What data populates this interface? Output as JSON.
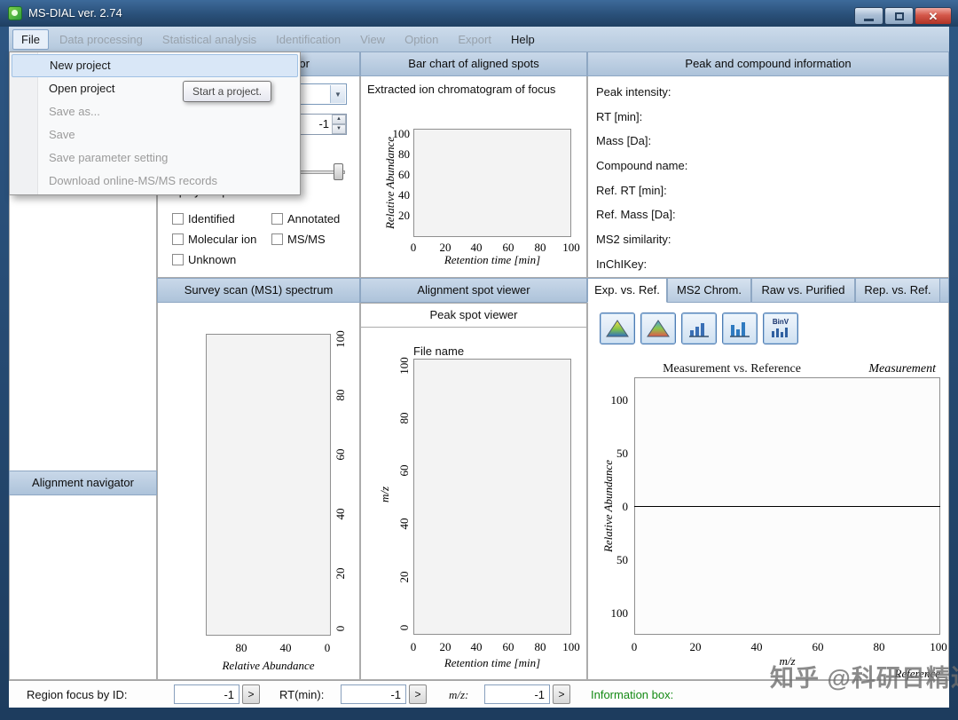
{
  "window": {
    "title": "MS-DIAL ver. 2.74"
  },
  "menubar": {
    "items": [
      {
        "label": "File"
      },
      {
        "label": "Data processing"
      },
      {
        "label": "Statistical analysis"
      },
      {
        "label": "Identification"
      },
      {
        "label": "View"
      },
      {
        "label": "Option"
      },
      {
        "label": "Export"
      },
      {
        "label": "Help"
      }
    ]
  },
  "file_menu": {
    "items": [
      {
        "label": "New project"
      },
      {
        "label": "Open project"
      },
      {
        "label": "Save as..."
      },
      {
        "label": "Save"
      },
      {
        "label": "Save parameter setting"
      },
      {
        "label": "Download online-MS/MS records"
      }
    ],
    "tooltip": "Start a project."
  },
  "navigator": {
    "peak_spot_header": "Peak spot navigator",
    "alignment_header": "Alignment navigator",
    "spinner_value": "-1",
    "displayed_label": "Displayed spots:",
    "filters": [
      "Identified",
      "Annotated",
      "Molecular ion",
      "MS/MS",
      "Unknown"
    ]
  },
  "bar_chart_panel": {
    "header": "Bar chart of aligned spots",
    "subheader": "Extracted ion chromatogram of focus",
    "ylabel": "Relative Abundance",
    "xlabel": "Retention time [min]",
    "yticks": [
      "100",
      "80",
      "60",
      "40",
      "20"
    ],
    "xticks": [
      "0",
      "20",
      "40",
      "60",
      "80",
      "100"
    ]
  },
  "survey_panel": {
    "header": "Survey scan (MS1) spectrum",
    "xlabel": "Relative Abundance",
    "xticks": [
      "80",
      "40",
      "0"
    ],
    "yticks": [
      "100",
      "80",
      "60",
      "40",
      "20",
      "0"
    ]
  },
  "spot_viewer_panel": {
    "header": "Alignment spot viewer",
    "subheader": "Peak spot viewer",
    "file_label": "File name",
    "ylabel": "m/z",
    "xlabel": "Retention time [min]",
    "yticks": [
      "100",
      "80",
      "60",
      "40",
      "20",
      "0"
    ],
    "xticks": [
      "0",
      "20",
      "40",
      "60",
      "80",
      "100"
    ]
  },
  "info_panel": {
    "header": "Peak and compound information",
    "fields": [
      "Peak intensity:",
      "RT [min]:",
      "Mass [Da]:",
      "Compound name:",
      "Ref. RT [min]:",
      "Ref. Mass [Da]:",
      "MS2 similarity:",
      "InChIKey:"
    ]
  },
  "ref_panel": {
    "tabs": [
      "Exp. vs. Ref.",
      "MS2 Chrom.",
      "Raw vs. Purified",
      "Rep. vs. Ref."
    ],
    "binv_label": "BinV",
    "chart": {
      "title": "Measurement vs. Reference",
      "top_right_label": "Measurement",
      "bottom_right_label": "Reference",
      "ylabel": "Relative Abundance",
      "xlabel": "m/z",
      "yticks": [
        "100",
        "50",
        "0",
        "50",
        "100"
      ],
      "xticks": [
        "0",
        "20",
        "40",
        "60",
        "80",
        "100"
      ]
    }
  },
  "bottom_bar": {
    "region_label": "Region focus by ID:",
    "rt_label": "RT(min):",
    "mz_label": "m/z:",
    "region_value": "-1",
    "rt_value": "-1",
    "mz_value": "-1",
    "go_label": ">",
    "info_label": "Information box:"
  },
  "watermark": "知乎 @科研日精进"
}
